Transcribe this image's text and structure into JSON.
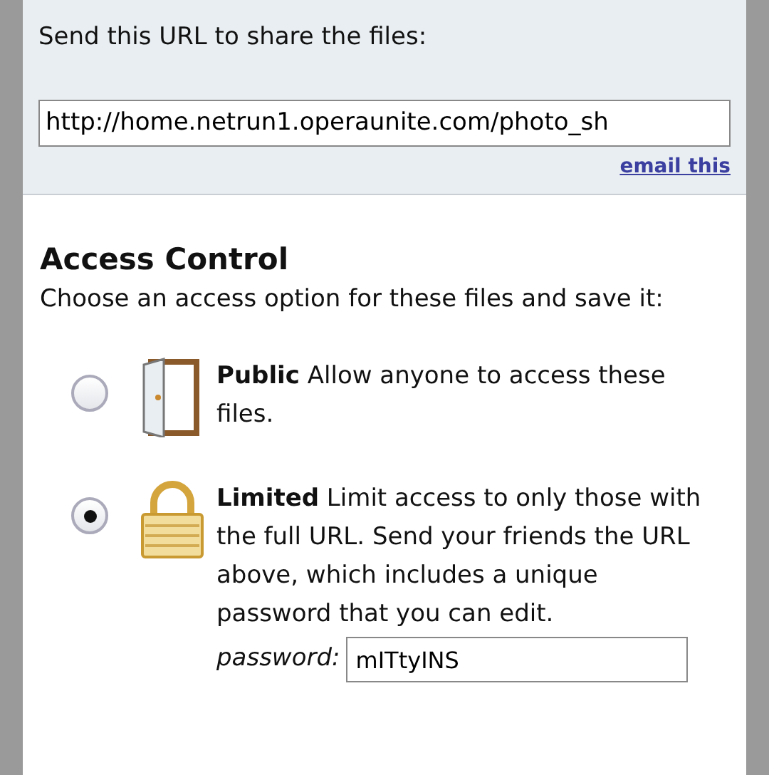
{
  "share": {
    "label": "Send this URL to share the files:",
    "url": "http://home.netrun1.operaunite.com/photo_sh",
    "email_link": "email this"
  },
  "access_control": {
    "title": "Access Control",
    "instruction": "Choose an access option for these files and save it:",
    "options": [
      {
        "kind": "door",
        "text": "**Public** Allow anyone to access these files.",
        "selected": false
      },
      {
        "kind": "lock",
        "text": "**Limited** Limit access to only those with the full URL. Send your friends the URL above, which includes a unique password that you can edit.",
        "selected": true,
        "password_label": "password:",
        "password": "mITtyINS"
      }
    ]
  }
}
